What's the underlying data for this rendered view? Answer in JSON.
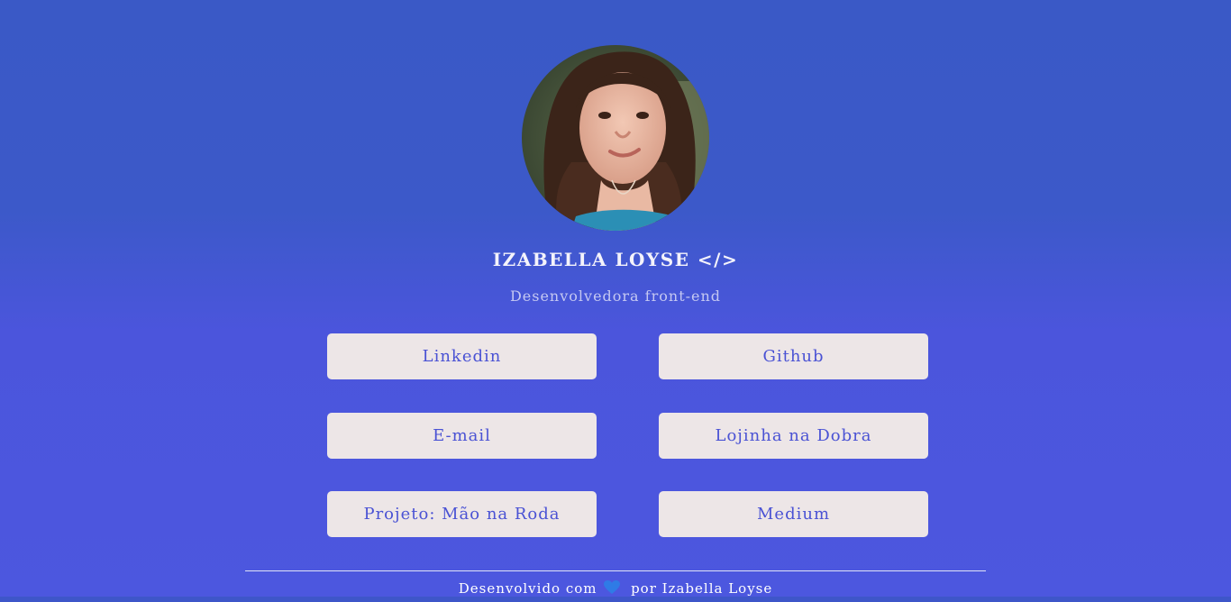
{
  "profile": {
    "name": "IZABELLA LOYSE </>",
    "role": "Desenvolvedora front-end"
  },
  "links": [
    {
      "label": "Linkedin"
    },
    {
      "label": "Github"
    },
    {
      "label": "E-mail"
    },
    {
      "label": "Lojinha na Dobra"
    },
    {
      "label": "Projeto: Mão na Roda"
    },
    {
      "label": "Medium"
    }
  ],
  "footer": {
    "prefix": "Desenvolvido com",
    "suffix": "por Izabella Loyse",
    "heart_icon": "blue-heart-icon",
    "heart_color": "#2f7be6"
  },
  "colors": {
    "background_top": "#3a59c6",
    "background_bottom": "#4c57df",
    "button_bg": "#ede6e7",
    "button_text": "#4a52d4"
  }
}
